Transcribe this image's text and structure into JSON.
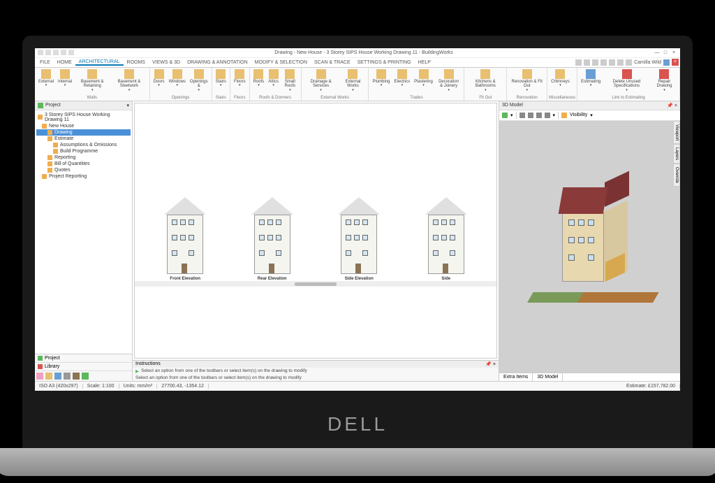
{
  "titlebar": {
    "title": "Drawing - New House - 3 Storey SIPS House Working Drawing 11 - BuildingWorks"
  },
  "menu": {
    "tabs": [
      "FILE",
      "HOME",
      "ARCHITECTURAL",
      "ROOMS",
      "VIEWS & 3D",
      "DRAWING & ANNOTATION",
      "MODIFY & SELECTION",
      "SCAN & TRACE",
      "SETTINGS & PRINTING",
      "HELP"
    ],
    "active": "ARCHITECTURAL",
    "user": "Camilla Wild"
  },
  "ribbon": {
    "groups": [
      {
        "label": "Walls",
        "items": [
          "External",
          "Internal",
          "Basement & Retaining",
          "Basement & Steelwork"
        ]
      },
      {
        "label": "Openings",
        "items": [
          "Doors",
          "Windows",
          "Openings & "
        ]
      },
      {
        "label": "Stairs",
        "items": [
          "Stairs"
        ]
      },
      {
        "label": "Floors",
        "items": [
          "Floors"
        ]
      },
      {
        "label": "Roofs & Dormers",
        "items": [
          "Roofs",
          "Attics",
          "Small Roofs"
        ]
      },
      {
        "label": "External Works",
        "items": [
          "Drainage & Services",
          "External Works"
        ]
      },
      {
        "label": "Trades",
        "items": [
          "Plumbing",
          "Electrics",
          "Plastering",
          "Decoration & Joinery"
        ]
      },
      {
        "label": "Fit Out",
        "items": [
          "Kitchens & Bathrooms"
        ]
      },
      {
        "label": "Renovation",
        "items": [
          "Renovation & Fit Out"
        ]
      },
      {
        "label": "Miscellaneous",
        "items": [
          "Chimneys"
        ]
      },
      {
        "label": "Link to Estimating",
        "items": [
          "Estimating",
          "Delete Unused Specifications",
          "Repair Drawing"
        ]
      }
    ]
  },
  "project": {
    "header": "Project",
    "root": "3 Storey SIPS House Working Drawing 11",
    "items": [
      {
        "label": "New House",
        "level": 1,
        "icon": "house"
      },
      {
        "label": "Drawing",
        "level": 2,
        "selected": true,
        "icon": "drawing"
      },
      {
        "label": "Estimate",
        "level": 2,
        "icon": "calc"
      },
      {
        "label": "Assumptions & Omissions",
        "level": 3,
        "icon": "list"
      },
      {
        "label": "Build Programme",
        "level": 3,
        "icon": "clock"
      },
      {
        "label": "Reporting",
        "level": 2,
        "icon": "report"
      },
      {
        "label": "Bill of Quantities",
        "level": 2,
        "icon": "bill"
      },
      {
        "label": "Quotes",
        "level": 2,
        "icon": "quote"
      },
      {
        "label": "Project Reporting",
        "level": 1,
        "icon": "report"
      }
    ],
    "tabs": [
      "Project",
      "Library"
    ]
  },
  "canvas": {
    "elevations": [
      "Front Elevation",
      "Rear Elevation",
      "Side Elevation",
      "Side"
    ]
  },
  "instructions": {
    "header": "Instructions",
    "lines": [
      "Select an option from one of the toolbars or select item(s) on the drawing to modify",
      "Select an option from one of the toolbars or select item(s) on the drawing to modify"
    ]
  },
  "model": {
    "header": "3D Model",
    "visibility": "Visibility",
    "tabs": [
      "Extra Items",
      "3D Model"
    ],
    "sidetabs": [
      "Viewport",
      "Layers",
      "Override"
    ]
  },
  "status": {
    "paper": "ISO A3 (420x297)",
    "scale": "Scale: 1:100",
    "units": "Units: mm/m²",
    "coords": "27700.43, -1354.12",
    "estimate": "Estimate: £157,782.00"
  }
}
